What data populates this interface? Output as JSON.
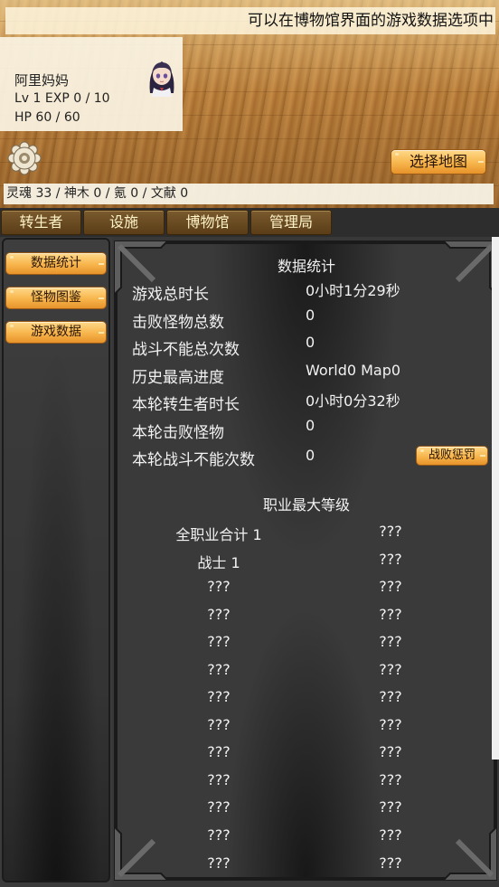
{
  "ticker": "可以在博物馆界面的游戏数据选项中",
  "character": {
    "name": "阿里妈妈",
    "level_exp": "Lv 1 EXP 0 / 10",
    "hp": "HP 60 / 60"
  },
  "icons": {
    "settings": "gear-icon",
    "avatar": "character-portrait"
  },
  "select_map_label": "选择地图",
  "resources": "灵魂 33 / 神木 0 / 氪 0 / 文献 0",
  "tabs": [
    "转生者",
    "设施",
    "博物馆",
    "管理局"
  ],
  "side_menu": [
    "数据统计",
    "怪物图鉴",
    "游戏数据"
  ],
  "stats": {
    "title": "数据统计",
    "rows": [
      {
        "label": "游戏总时长",
        "value": "0小时1分29秒"
      },
      {
        "label": "击败怪物总数",
        "value": "0"
      },
      {
        "label": "战斗不能总次数",
        "value": "0"
      },
      {
        "label": "历史最高进度",
        "value": "World0 Map0"
      },
      {
        "label": "本轮转生者时长",
        "value": "0小时0分32秒"
      },
      {
        "label": "本轮击败怪物",
        "value": "0"
      },
      {
        "label": "本轮战斗不能次数",
        "value": "0"
      }
    ],
    "penalty_button": "战败惩罚"
  },
  "levels": {
    "title": "职业最大等级",
    "rows": [
      {
        "name": "全职业合计 1",
        "value": "???"
      },
      {
        "name": "战士 1",
        "value": "???"
      },
      {
        "name": "???",
        "value": "???"
      },
      {
        "name": "???",
        "value": "???"
      },
      {
        "name": "???",
        "value": "???"
      },
      {
        "name": "???",
        "value": "???"
      },
      {
        "name": "???",
        "value": "???"
      },
      {
        "name": "???",
        "value": "???"
      },
      {
        "name": "???",
        "value": "???"
      },
      {
        "name": "???",
        "value": "???"
      },
      {
        "name": "???",
        "value": "???"
      },
      {
        "name": "???",
        "value": "???"
      },
      {
        "name": "???",
        "value": "???"
      }
    ]
  },
  "colors": {
    "accent_button": "#f7b54c",
    "tab_bg": "#5a3d17",
    "panel_bg": "#3a3a3a",
    "text_light": "#f2f2f2"
  }
}
